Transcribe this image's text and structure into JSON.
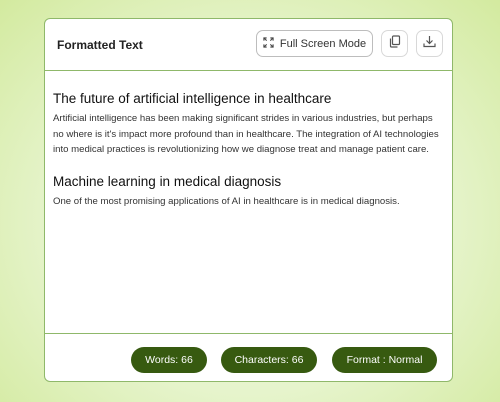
{
  "header": {
    "title": "Formatted Text",
    "fullscreen_label": "Full Screen Mode",
    "icons": {
      "fullscreen": "expand-icon",
      "copy": "copy-icon",
      "download": "download-icon"
    }
  },
  "content": {
    "sections": [
      {
        "heading": "The future of artificial intelligence in healthcare",
        "body": "Artificial intelligence has been making significant strides in various industries, but perhaps no where is it's impact more profound than in healthcare. The integration of AI technologies into medical practices is revolutionizing how we diagnose treat and manage patient care."
      },
      {
        "heading": "Machine learning in medical diagnosis",
        "body": "One of the most promising applications of AI in healthcare is in medical diagnosis."
      }
    ]
  },
  "footer": {
    "words": "Words: 66",
    "characters": "Characters: 66",
    "format": "Format : Normal"
  },
  "colors": {
    "accent": "#375a10",
    "border": "#8fb86a"
  }
}
